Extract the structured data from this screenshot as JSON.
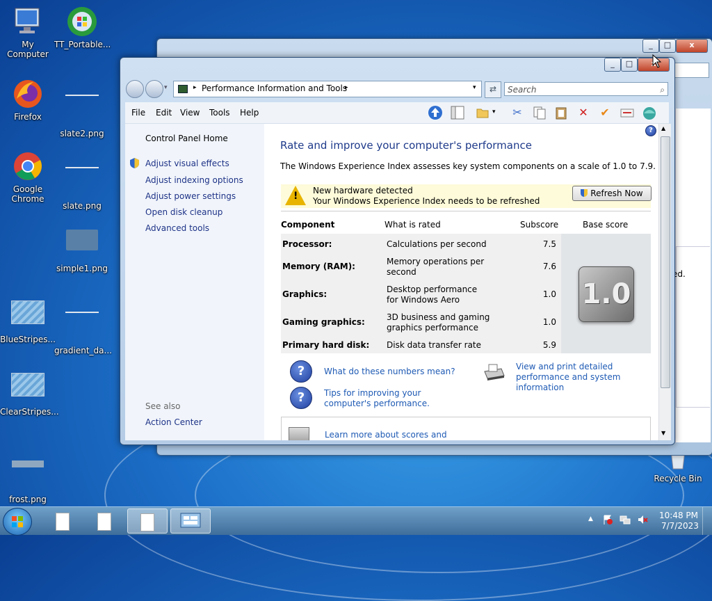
{
  "desktop": {
    "icons": [
      {
        "label": "My Computer"
      },
      {
        "label": "TT_Portable..."
      },
      {
        "label": "Firefox"
      },
      {
        "label": "slate2.png"
      },
      {
        "label": "Google Chrome"
      },
      {
        "label": "slate.png"
      },
      {
        "label": "simple1.png"
      },
      {
        "label": "BlueStripes..."
      },
      {
        "label": "gradient_da..."
      },
      {
        "label": "ClearStripes..."
      },
      {
        "label": "frost.png"
      },
      {
        "label": "Recycle Bin"
      }
    ]
  },
  "back_window": {
    "partial_text": "ed."
  },
  "window": {
    "breadcrumb": "Performance Information and Tools",
    "search_placeholder": "Search",
    "menu": [
      "File",
      "Edit",
      "View",
      "Tools",
      "Help"
    ],
    "left_pane": {
      "home": "Control Panel Home",
      "links": [
        "Adjust visual effects",
        "Adjust indexing options",
        "Adjust power settings",
        "Open disk cleanup",
        "Advanced tools"
      ],
      "see_also_title": "See also",
      "see_also": [
        "Action Center"
      ]
    },
    "content": {
      "title": "Rate and improve your computer's performance",
      "description": "The Windows Experience Index assesses key system components on a scale of 1.0 to 7.9.",
      "alert_line1": "New hardware detected",
      "alert_line2": "Your Windows Experience Index needs to be refreshed",
      "refresh_button": "Refresh Now",
      "headers": {
        "component": "Component",
        "rated": "What is rated",
        "subscore": "Subscore",
        "base": "Base score"
      },
      "rows": [
        {
          "component": "Processor:",
          "rated": "Calculations per second",
          "subscore": "7.5"
        },
        {
          "component": "Memory (RAM):",
          "rated": "Memory operations per second",
          "subscore": "7.6"
        },
        {
          "component": "Graphics:",
          "rated": "Desktop performance for Windows Aero",
          "subscore": "1.0"
        },
        {
          "component": "Gaming graphics:",
          "rated": "3D business and gaming graphics performance",
          "subscore": "1.0"
        },
        {
          "component": "Primary hard disk:",
          "rated": "Disk data transfer rate",
          "subscore": "5.9"
        }
      ],
      "base_score": "1.0",
      "link_numbers": "What do these numbers mean?",
      "link_tips": "Tips for improving your computer's performance.",
      "link_print": "View and print detailed performance and system information",
      "link_learn": "Learn more about scores and"
    }
  },
  "taskbar": {
    "time": "10:48 PM",
    "date": "7/7/2023"
  },
  "colors": {
    "link": "#1e5ab4",
    "title": "#1e3a8a",
    "alert_bg": "#fdfbd9"
  }
}
